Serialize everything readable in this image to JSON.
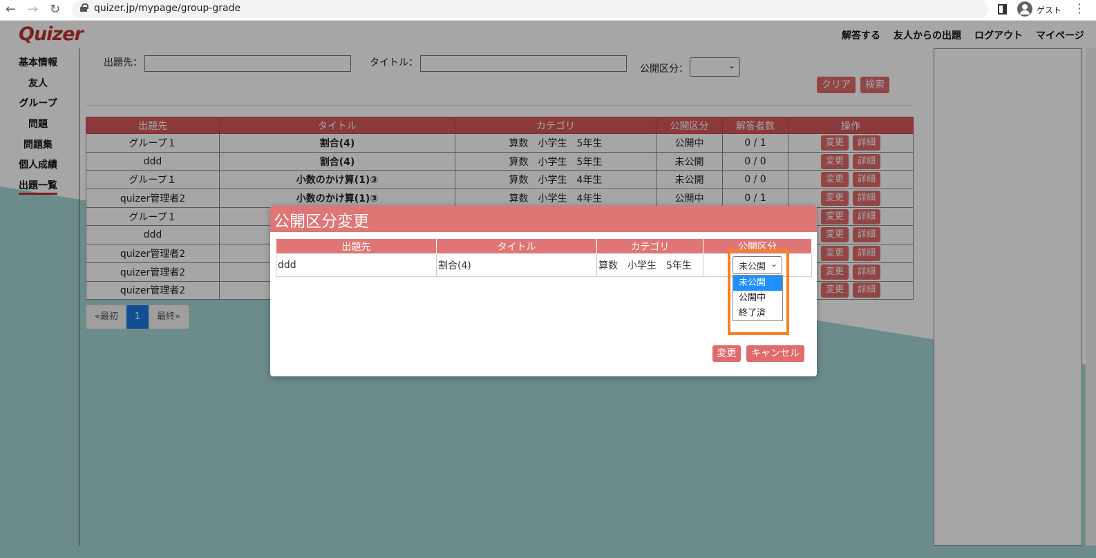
{
  "browser": {
    "url": "quizer.jp/mypage/group-grade",
    "profile_label": "ゲスト"
  },
  "header": {
    "logo": "Quizer",
    "nav": [
      "解答する",
      "友人からの出題",
      "ログアウト",
      "マイページ"
    ]
  },
  "sidebar": {
    "items": [
      "基本情報",
      "友人",
      "グループ",
      "問題",
      "問題集",
      "個人成績",
      "出題一覧"
    ],
    "active": "出題一覧"
  },
  "search": {
    "target_label": "出題先：",
    "title_label": "タイトル：",
    "status_label": "公開区分：",
    "clear_label": "クリア",
    "search_label": "検索"
  },
  "table": {
    "columns": [
      "出題先",
      "タイトル",
      "カテゴリ",
      "公開区分",
      "解答者数",
      "操作"
    ],
    "edit_label": "変更",
    "detail_label": "詳細",
    "rows": [
      {
        "target": "グループ１",
        "title": "割合(4)",
        "category": "算数　小学生　5年生",
        "status": "公開中",
        "count": "0 / 1"
      },
      {
        "target": "ddd",
        "title": "割合(4)",
        "category": "算数　小学生　5年生",
        "status": "未公開",
        "count": "0 / 0"
      },
      {
        "target": "グループ１",
        "title": "小数のかけ算(1)③",
        "category": "算数　小学生　4年生",
        "status": "未公開",
        "count": "0 / 0"
      },
      {
        "target": "quizer管理者2",
        "title": "小数のかけ算(1)③",
        "category": "算数　小学生　4年生",
        "status": "公開中",
        "count": "0 / 1"
      },
      {
        "target": "グループ１",
        "title": "",
        "category": "",
        "status": "",
        "count": ""
      },
      {
        "target": "ddd",
        "title": "",
        "category": "",
        "status": "",
        "count": ""
      },
      {
        "target": "quizer管理者2",
        "title": "",
        "category": "",
        "status": "",
        "count": ""
      },
      {
        "target": "quizer管理者2",
        "title": "",
        "category": "",
        "status": "",
        "count": ""
      },
      {
        "target": "quizer管理者2",
        "title": "",
        "category": "",
        "status": "",
        "count": ""
      }
    ]
  },
  "pager": {
    "first": "«最初",
    "current": "1",
    "last": "最終»"
  },
  "modal": {
    "title": "公開区分変更",
    "columns": [
      "出題先",
      "タイトル",
      "カテゴリ",
      "公開区分"
    ],
    "row": {
      "target": "ddd",
      "title": "割合(4)",
      "category": "算数　小学生　5年生"
    },
    "select_value": "未公開",
    "options": [
      "未公開",
      "公開中",
      "終了済"
    ],
    "highlighted_option": "未公開",
    "submit_label": "変更",
    "cancel_label": "キャンセル"
  },
  "colors": {
    "accent": "#e06b6b",
    "header_red": "#d45a5a",
    "highlight_orange": "#f58220",
    "selected_blue": "#1e90ff"
  }
}
